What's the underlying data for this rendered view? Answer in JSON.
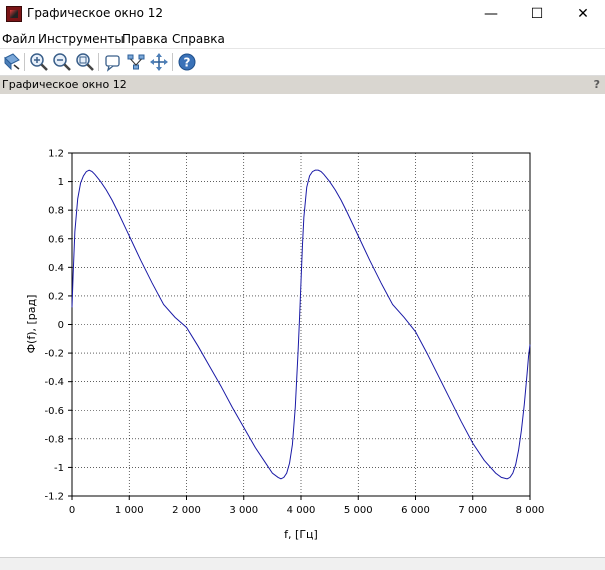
{
  "window": {
    "title": "Графическое окно 12",
    "minimize_symbol": "—",
    "maximize_symbol": "☐",
    "close_symbol": "✕"
  },
  "menu": {
    "items": [
      "Файл",
      "Инструменты",
      "Правка",
      "Справка"
    ]
  },
  "toolbar": {
    "icons": [
      "rotate-icon",
      "zoom-in-icon",
      "zoom-out-icon",
      "zoom-area-icon",
      "datatip-icon",
      "editor-icon",
      "pan-icon",
      "help-icon"
    ]
  },
  "infobar": {
    "title": "Графическое окно 12",
    "help": "?"
  },
  "colors": {
    "curve": "#1a1aa6",
    "grid": "#000000",
    "infobar": "#d9d6d0"
  },
  "chart_data": {
    "type": "line",
    "title": "",
    "xlabel": "f, [Гц]",
    "ylabel": "Ф(f), [рад]",
    "xlim": [
      0,
      8000
    ],
    "ylim": [
      -1.2,
      1.2
    ],
    "grid": true,
    "x_ticks": [
      0,
      1000,
      2000,
      3000,
      4000,
      5000,
      6000,
      7000,
      8000
    ],
    "x_tick_labels": [
      "0",
      "1 000",
      "2 000",
      "3 000",
      "4 000",
      "5 000",
      "6 000",
      "7 000",
      "8 000"
    ],
    "y_ticks": [
      1.2,
      1,
      0.8,
      0.6,
      0.4,
      0.2,
      0,
      -0.2,
      -0.4,
      -0.6,
      -0.8,
      -1,
      -1.2
    ],
    "y_tick_labels": [
      "1.2",
      "1",
      "0.8",
      "0.6",
      "0.4",
      "0.2",
      "0",
      "-0.2",
      "-0.4",
      "-0.6",
      "-0.8",
      "-1",
      "-1.2"
    ],
    "series": [
      {
        "x": [
          0,
          20,
          50,
          100,
          150,
          200,
          250,
          300,
          350,
          400,
          500,
          600,
          700,
          800,
          1000,
          1200,
          1400,
          1600,
          1800,
          2000,
          2200,
          2400,
          2600,
          2800,
          3000,
          3200,
          3400,
          3500,
          3600,
          3650,
          3700,
          3750,
          3800,
          3850,
          3900,
          3950,
          3975,
          4000,
          4025,
          4050,
          4100,
          4150,
          4200,
          4250,
          4300,
          4350,
          4400,
          4500,
          4600,
          4700,
          4800,
          5000,
          5200,
          5400,
          5600,
          5800,
          6000,
          6200,
          6400,
          6600,
          6800,
          7000,
          7200,
          7400,
          7500,
          7600,
          7650,
          7700,
          7750,
          7800,
          7850,
          7900,
          7950,
          7975,
          8000
        ],
        "y": [
          0.12,
          0.35,
          0.65,
          0.88,
          0.99,
          1.04,
          1.07,
          1.08,
          1.07,
          1.05,
          1.0,
          0.94,
          0.87,
          0.79,
          0.62,
          0.45,
          0.29,
          0.14,
          0.05,
          -0.02,
          -0.15,
          -0.29,
          -0.43,
          -0.58,
          -0.72,
          -0.86,
          -0.98,
          -1.04,
          -1.07,
          -1.08,
          -1.07,
          -1.04,
          -0.97,
          -0.84,
          -0.58,
          -0.18,
          0.05,
          0.3,
          0.55,
          0.75,
          0.96,
          1.04,
          1.07,
          1.08,
          1.08,
          1.07,
          1.05,
          1.0,
          0.94,
          0.87,
          0.79,
          0.62,
          0.45,
          0.29,
          0.14,
          0.05,
          -0.05,
          -0.2,
          -0.36,
          -0.52,
          -0.68,
          -0.83,
          -0.95,
          -1.04,
          -1.07,
          -1.08,
          -1.07,
          -1.04,
          -0.98,
          -0.88,
          -0.74,
          -0.56,
          -0.34,
          -0.22,
          -0.14
        ]
      }
    ]
  }
}
